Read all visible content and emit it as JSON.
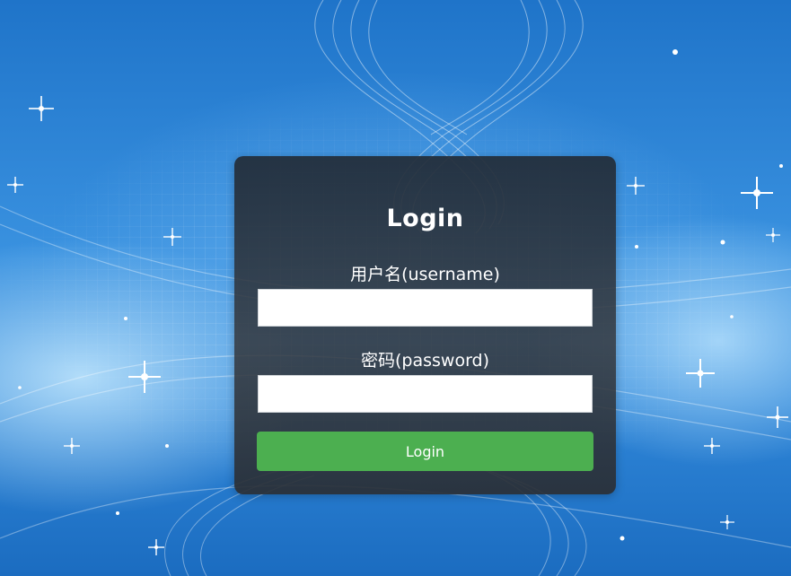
{
  "login": {
    "title": "Login",
    "username_label": "用户名(username)",
    "username_value": "",
    "password_label": "密码(password)",
    "password_value": "",
    "submit_label": "Login"
  },
  "colors": {
    "background_blue": "#2f86d8",
    "panel_dark": "#2b333c",
    "button_green": "#4caf50",
    "text_white": "#ffffff"
  }
}
